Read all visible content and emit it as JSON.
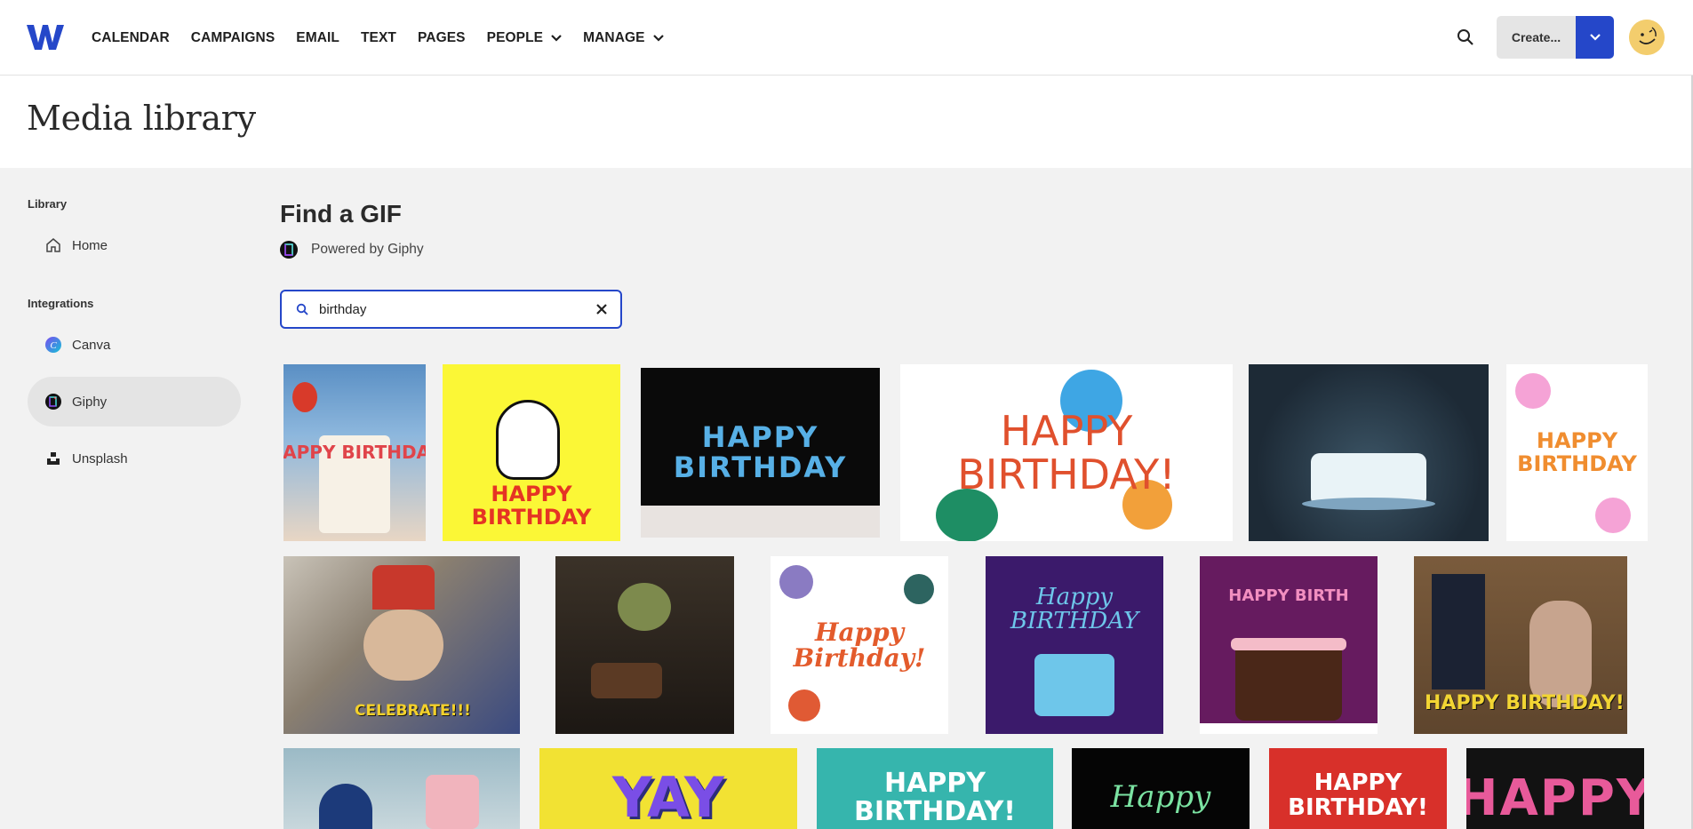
{
  "nav": {
    "items": [
      {
        "label": "CALENDAR",
        "dropdown": false
      },
      {
        "label": "CAMPAIGNS",
        "dropdown": false
      },
      {
        "label": "EMAIL",
        "dropdown": false
      },
      {
        "label": "TEXT",
        "dropdown": false
      },
      {
        "label": "PAGES",
        "dropdown": false
      },
      {
        "label": "PEOPLE",
        "dropdown": true
      },
      {
        "label": "MANAGE",
        "dropdown": true
      }
    ],
    "create_label": "Create...",
    "accent": "#2547c9"
  },
  "page": {
    "title": "Media library"
  },
  "sidebar": {
    "library_heading": "Library",
    "home_label": "Home",
    "integrations_heading": "Integrations",
    "canva_label": "Canva",
    "giphy_label": "Giphy",
    "unsplash_label": "Unsplash",
    "active": "Giphy"
  },
  "main": {
    "title": "Find a GIF",
    "powered_by": "Powered by Giphy",
    "search": {
      "value": "birthday",
      "placeholder": ""
    }
  },
  "gifs": [
    {
      "caption": "HAPPY BIRTHDAY"
    },
    {
      "caption": "HAPPY BIRTHDAY"
    },
    {
      "caption": "HAPPY BIRTHDAY"
    },
    {
      "caption": "HAPPY BIRTHDAY!"
    },
    {
      "caption": ""
    },
    {
      "caption": "HAPPY BIRTHDAY"
    },
    {
      "caption": "CELEBRATE!!!"
    },
    {
      "caption": ""
    },
    {
      "caption": "Happy Birthday!"
    },
    {
      "caption": "Happy BIRTHDAY"
    },
    {
      "caption": "HAPPY BIRTH"
    },
    {
      "caption": "HAPPY BIRTHDAY!"
    },
    {
      "caption": ""
    },
    {
      "caption": "YAY"
    },
    {
      "caption": "HAPPY BIRTHDAY!"
    },
    {
      "caption": "Happy"
    },
    {
      "caption": "HAPPY BIRTHDAY!"
    },
    {
      "caption": "HAPPY"
    }
  ]
}
